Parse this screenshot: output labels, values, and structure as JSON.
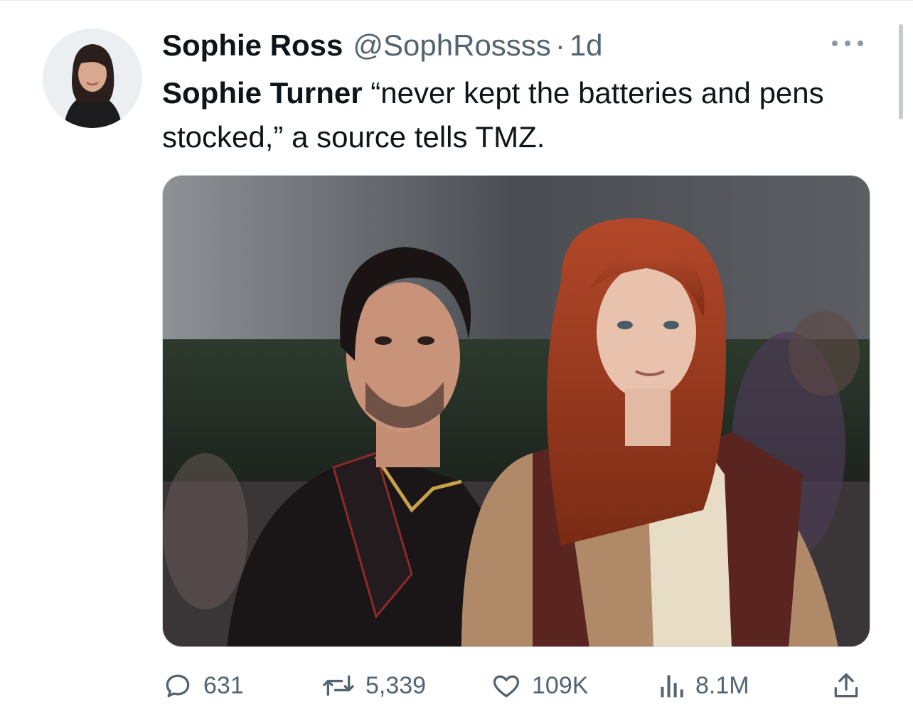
{
  "tweet": {
    "author_name": "Sophie Ross",
    "author_handle": "@SophRossss",
    "separator": "·",
    "time": "1d",
    "text_bold": "Sophie Turner",
    "text_rest": " “never kept the batteries and pens stocked,” a source tells TMZ.",
    "image_name": "photo-of-couple"
  },
  "actions": {
    "replies": "631",
    "retweets": "5,339",
    "likes": "109K",
    "views": "8.1M"
  },
  "icons": [
    "more-icon",
    "reply-icon",
    "retweet-icon",
    "like-icon",
    "views-icon",
    "share-icon"
  ],
  "colors": {
    "text_primary": "#0f1419",
    "text_secondary": "#536471"
  }
}
